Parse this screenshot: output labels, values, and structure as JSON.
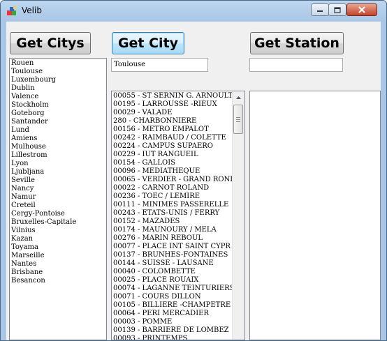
{
  "window": {
    "title": "Velib"
  },
  "buttons": {
    "get_citys": "Get Citys",
    "get_city": "Get City",
    "get_station": "Get Station"
  },
  "inputs": {
    "city_value": "Toulouse",
    "station_value": ""
  },
  "cities": [
    "Rouen",
    "Toulouse",
    "Luxembourg",
    "Dublin",
    "Valence",
    "Stockholm",
    "Goteborg",
    "Santander",
    "Lund",
    "Amiens",
    "Mulhouse",
    "Lillestrom",
    "Lyon",
    "Ljubljana",
    "Seville",
    "Nancy",
    "Namur",
    "Creteil",
    "Cergy-Pontoise",
    "Bruxelles-Capitale",
    "Vilnius",
    "Kazan",
    "Toyama",
    "Marseille",
    "Nantes",
    "Brisbane",
    "Besancon"
  ],
  "stations": [
    "00055 - ST SERNIN G. ARNOULT",
    "00195 - LARROUSSE -RIEUX",
    "00029 - VALADE",
    "280 - CHARBONNIERE",
    "00156 - METRO EMPALOT",
    "00242 -  RAIMBAUD / COLETTE",
    "00224 - CAMPUS SUPAERO",
    "00229 - IUT RANGUEIL",
    "00154 - GALLOIS",
    "00096 - MEDIATHEQUE",
    "00065 - VERDIER - GRAND ROND",
    "00022 - CARNOT ROLAND",
    "00236 - TOEC / LEMIRE",
    "00111 - MINIMES PASSERELLE",
    "00243 - ETATS-UNIS / FERRY",
    "00152 - MAZADES",
    "00174 - MAUNOURY / MELA",
    "00276 - MARIN REBOUL",
    "00077 - PLACE INT SAINT CYPR",
    "00137 - BRUNHES-FONTAINES",
    "00144 - SUISSE - LAUSANE",
    "00040 - COLOMBETTE",
    "00025 - PLACE ROUAIX",
    "00074 - LAGANNE TEINTURIERS",
    "00071 - COURS DILLON",
    "00105 - BILLIERE -CHAMPETRE",
    "00064 - PERI MERCADIER",
    "00003 - POMME",
    "00139 - BARRIERE DE LOMBEZ",
    "00093 - PRINTEMPS"
  ]
}
